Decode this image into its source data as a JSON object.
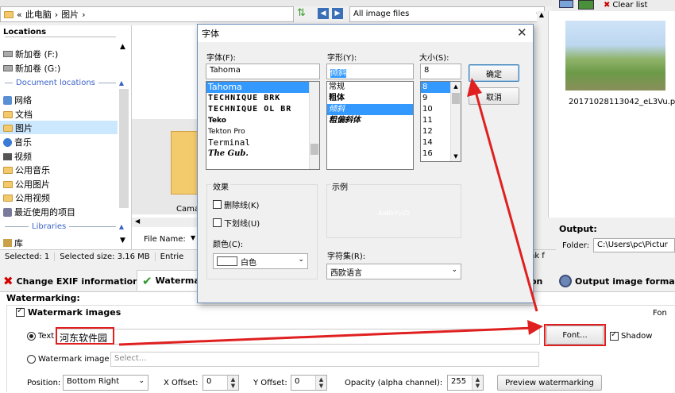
{
  "explorer": {
    "path_arrow": "«",
    "path_parts": [
      "此电脑",
      "图片"
    ],
    "sep": "›",
    "filter": "All image files",
    "locations_header": "Locations",
    "tree": [
      "新加卷 (F:)",
      "新加卷 (G:)"
    ],
    "document_locations": "Document locations",
    "doc_items": [
      "网络",
      "文档",
      "图片",
      "音乐",
      "视频",
      "公用音乐",
      "公用图片",
      "公用视频",
      "最近使用的项目"
    ],
    "libraries": "Libraries",
    "library_item": "库",
    "folder_label": "Cama",
    "file_name_label": "File Name:",
    "status_selected": "Selected: 1",
    "status_size": "Selected size: 3.16 MB",
    "status_entries": "Entrie",
    "status_right": "nk f"
  },
  "preview": {
    "clear_list": "Clear list",
    "filename": "20171028113042_eL3Vu.p",
    "output_label": "Output:",
    "folder_label": "Folder:",
    "folder_value": "C:\\Users\\pc\\Pictur"
  },
  "tabs": {
    "exif": "Change EXIF information",
    "watermark": "Watermark",
    "other": "on",
    "output_format": "Output image format"
  },
  "watermarking": {
    "section_title": "Watermarking:",
    "watermark_images": "Watermark images",
    "text_label": "Text",
    "text_value": "河东软件园",
    "font_button": "Font...",
    "shadow": "Shadow",
    "font_partial": "Fon",
    "image_label": "Watermark image",
    "image_placeholder": "Select...",
    "position_label": "Position:",
    "position_value": "Bottom Right",
    "x_offset_label": "X Offset:",
    "x_offset": "0",
    "y_offset_label": "Y Offset:",
    "y_offset": "0",
    "opacity_label": "Opacity (alpha channel):",
    "opacity": "255",
    "preview_button": "Preview watermarking"
  },
  "font_dialog": {
    "title": "字体",
    "font_label": "字体(F):",
    "font_value": "Tahoma",
    "fonts": [
      "Tahoma",
      "TECHNIQUE BRK",
      "TECHNIQUE OL BR",
      "Teko",
      "Tekton Pro",
      "Terminal",
      "The Gub."
    ],
    "style_label": "字形(Y):",
    "style_value": "倾斜",
    "styles": [
      "常规",
      "粗体",
      "倾斜",
      "粗偏斜体"
    ],
    "size_label": "大小(S):",
    "size_value": "8",
    "sizes": [
      "8",
      "9",
      "10",
      "11",
      "12",
      "14",
      "16"
    ],
    "ok": "确定",
    "cancel": "取消",
    "effects_label": "效果",
    "strikeout": "删除线(K)",
    "underline": "下划线(U)",
    "color_label": "颜色(C):",
    "color_value": "白色",
    "sample_label": "示例",
    "sample_text": "AaBbYyZz",
    "script_label": "字符集(R):",
    "script_value": "西欧语言"
  }
}
